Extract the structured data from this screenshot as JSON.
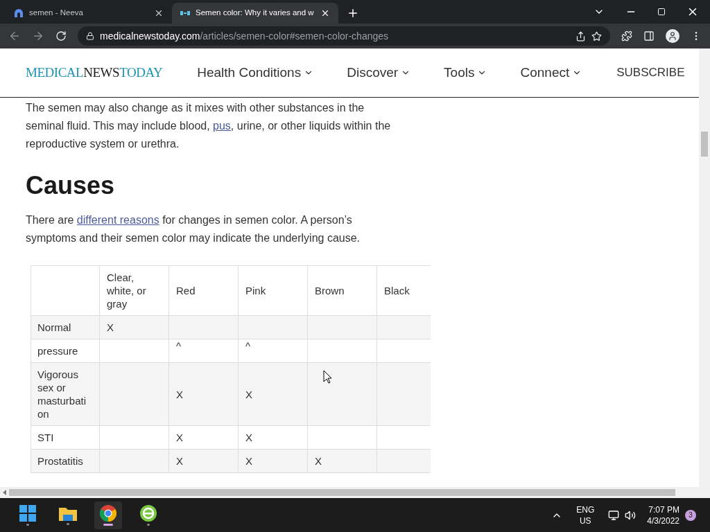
{
  "browser": {
    "tabs": [
      {
        "title": "semen - Neeva",
        "selected": false
      },
      {
        "title": "Semen color: Why it varies and w",
        "selected": true
      }
    ],
    "address": {
      "host": "medicalnewstoday.com",
      "path": "/articles/semen-color#semen-color-changes"
    }
  },
  "site_header": {
    "logo": [
      "MEDICAL",
      "NEWS",
      "TODAY"
    ],
    "nav": [
      "Health Conditions",
      "Discover",
      "Tools",
      "Connect"
    ],
    "subscribe": "SUBSCRIBE"
  },
  "article": {
    "intro": [
      [
        {
          "text": "The semen may also change as it mixes with other substances in the"
        }
      ],
      [
        {
          "text": "seminal fluid. This may include blood, "
        },
        {
          "text": "pus",
          "kind": "link"
        },
        {
          "text": ", urine, or other liquids within the"
        }
      ],
      [
        {
          "text": "reproductive system or urethra."
        }
      ]
    ],
    "heading": "Causes",
    "paragraph": [
      {
        "text": "There are "
      },
      {
        "text": "different reasons",
        "kind": "link"
      },
      {
        "text": " for changes in semen color. A person’s symptoms and their semen color may indicate the underlying cause."
      }
    ],
    "table": {
      "columns": [
        "Clear, white, or gray",
        "Red",
        "Pink",
        "Brown",
        "Black"
      ],
      "rows": [
        {
          "label": "Normal",
          "cells": [
            "X",
            null,
            null,
            null,
            null
          ]
        },
        {
          "label": "pressure",
          "cells": [
            null,
            "^",
            "^",
            null,
            null
          ]
        },
        {
          "label": "Vigorous sex or masturbati on",
          "cells": [
            null,
            "X",
            "X",
            null,
            null
          ]
        },
        {
          "label": "STI",
          "cells": [
            null,
            "X",
            "X",
            null,
            null
          ]
        },
        {
          "label": "Prostatitis",
          "cells": [
            null,
            "X",
            "X",
            "X",
            null
          ]
        }
      ]
    }
  },
  "taskbar": {
    "apps": [
      {
        "kind": "windows",
        "active": false
      },
      {
        "kind": "folder",
        "active": false
      },
      {
        "kind": "chrome",
        "active": true
      },
      {
        "kind": "green",
        "active": false
      }
    ],
    "language": "ENG",
    "region": "US",
    "time": "7:07 PM",
    "date": "4/3/2022",
    "badge": "3"
  }
}
